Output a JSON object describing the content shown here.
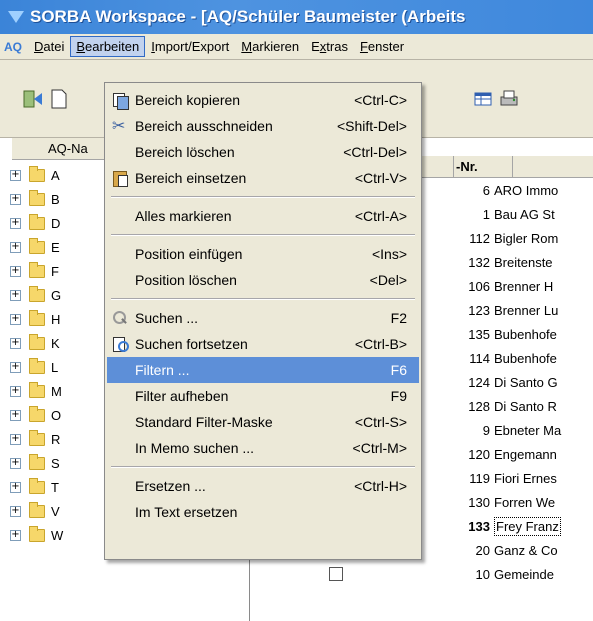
{
  "window": {
    "title": "SORBA Workspace - [AQ/Schüler Baumeister (Arbeits"
  },
  "menubar": {
    "app_badge": "AQ",
    "items": [
      {
        "label": "Datei",
        "underline": "D",
        "open": false
      },
      {
        "label": "Bearbeiten",
        "underline": "B",
        "open": true
      },
      {
        "label": "Import/Export",
        "underline": "I",
        "open": false
      },
      {
        "label": "Markieren",
        "underline": "M",
        "open": false
      },
      {
        "label": "Extras",
        "underline": "x",
        "open": false
      },
      {
        "label": "Fenster",
        "underline": "F",
        "open": false
      }
    ]
  },
  "tree": {
    "header": "AQ-Na",
    "items": [
      "A",
      "B",
      "D",
      "E",
      "F",
      "G",
      "H",
      "K",
      "L",
      "M",
      "O",
      "R",
      "S",
      "T",
      "V",
      "W"
    ]
  },
  "grid": {
    "col_nr": "-Nr.",
    "rows": [
      {
        "nr": "6",
        "name": "ARO Immo"
      },
      {
        "nr": "1",
        "name": "Bau AG St"
      },
      {
        "nr": "112",
        "name": "Bigler Rom"
      },
      {
        "nr": "132",
        "name": "Breitenste"
      },
      {
        "nr": "106",
        "name": "Brenner H"
      },
      {
        "nr": "123",
        "name": "Brenner Lu"
      },
      {
        "nr": "135",
        "name": "Bubenhofe"
      },
      {
        "nr": "114",
        "name": "Bubenhofe"
      },
      {
        "nr": "124",
        "name": "Di Santo G"
      },
      {
        "nr": "128",
        "name": "Di Santo R"
      },
      {
        "nr": "9",
        "name": "Ebneter Ma"
      },
      {
        "nr": "120",
        "name": "Engemann"
      },
      {
        "nr": "119",
        "name": "Fiori Ernes"
      },
      {
        "nr": "130",
        "name": "Forren We"
      },
      {
        "nr": "133",
        "name": "Frey Franz",
        "selected": true
      },
      {
        "nr": "20",
        "name": "Ganz & Co"
      },
      {
        "nr": "10",
        "name": "Gemeinde"
      }
    ]
  },
  "dropdown": {
    "items": [
      {
        "type": "item",
        "icon": "copy-icon",
        "label": "Bereich kopieren",
        "shortcut": "<Ctrl-C>"
      },
      {
        "type": "item",
        "icon": "cut-icon",
        "label": "Bereich ausschneiden",
        "shortcut": "<Shift-Del>"
      },
      {
        "type": "item",
        "icon": "",
        "label": "Bereich löschen",
        "shortcut": "<Ctrl-Del>"
      },
      {
        "type": "item",
        "icon": "paste-icon",
        "label": "Bereich einsetzen",
        "shortcut": "<Ctrl-V>"
      },
      {
        "type": "sep"
      },
      {
        "type": "item",
        "icon": "",
        "label": "Alles markieren",
        "shortcut": "<Ctrl-A>"
      },
      {
        "type": "sep"
      },
      {
        "type": "item",
        "icon": "",
        "label": "Position einfügen",
        "shortcut": "<Ins>"
      },
      {
        "type": "item",
        "icon": "",
        "label": "Position löschen",
        "shortcut": "<Del>"
      },
      {
        "type": "sep"
      },
      {
        "type": "item",
        "icon": "search-icon",
        "label": "Suchen ...",
        "shortcut": "F2"
      },
      {
        "type": "item",
        "icon": "search-next-icon",
        "label": "Suchen fortsetzen",
        "shortcut": "<Ctrl-B>"
      },
      {
        "type": "item",
        "icon": "",
        "label": "Filtern ...",
        "shortcut": "F6",
        "highlight": true
      },
      {
        "type": "item",
        "icon": "",
        "label": "Filter aufheben",
        "shortcut": "F9"
      },
      {
        "type": "item",
        "icon": "",
        "label": "Standard Filter-Maske",
        "shortcut": "<Ctrl-S>"
      },
      {
        "type": "item",
        "icon": "",
        "label": "In Memo suchen ...",
        "shortcut": "<Ctrl-M>"
      },
      {
        "type": "sep"
      },
      {
        "type": "item",
        "icon": "",
        "label": "Ersetzen ...",
        "shortcut": "<Ctrl-H>"
      },
      {
        "type": "item",
        "icon": "",
        "label": "Im Text ersetzen",
        "shortcut": ""
      }
    ]
  },
  "colors": {
    "titlebar": "#3b84d8",
    "menu_highlight": "#5d8fd8",
    "menubar_bg": "#ece9d8"
  }
}
